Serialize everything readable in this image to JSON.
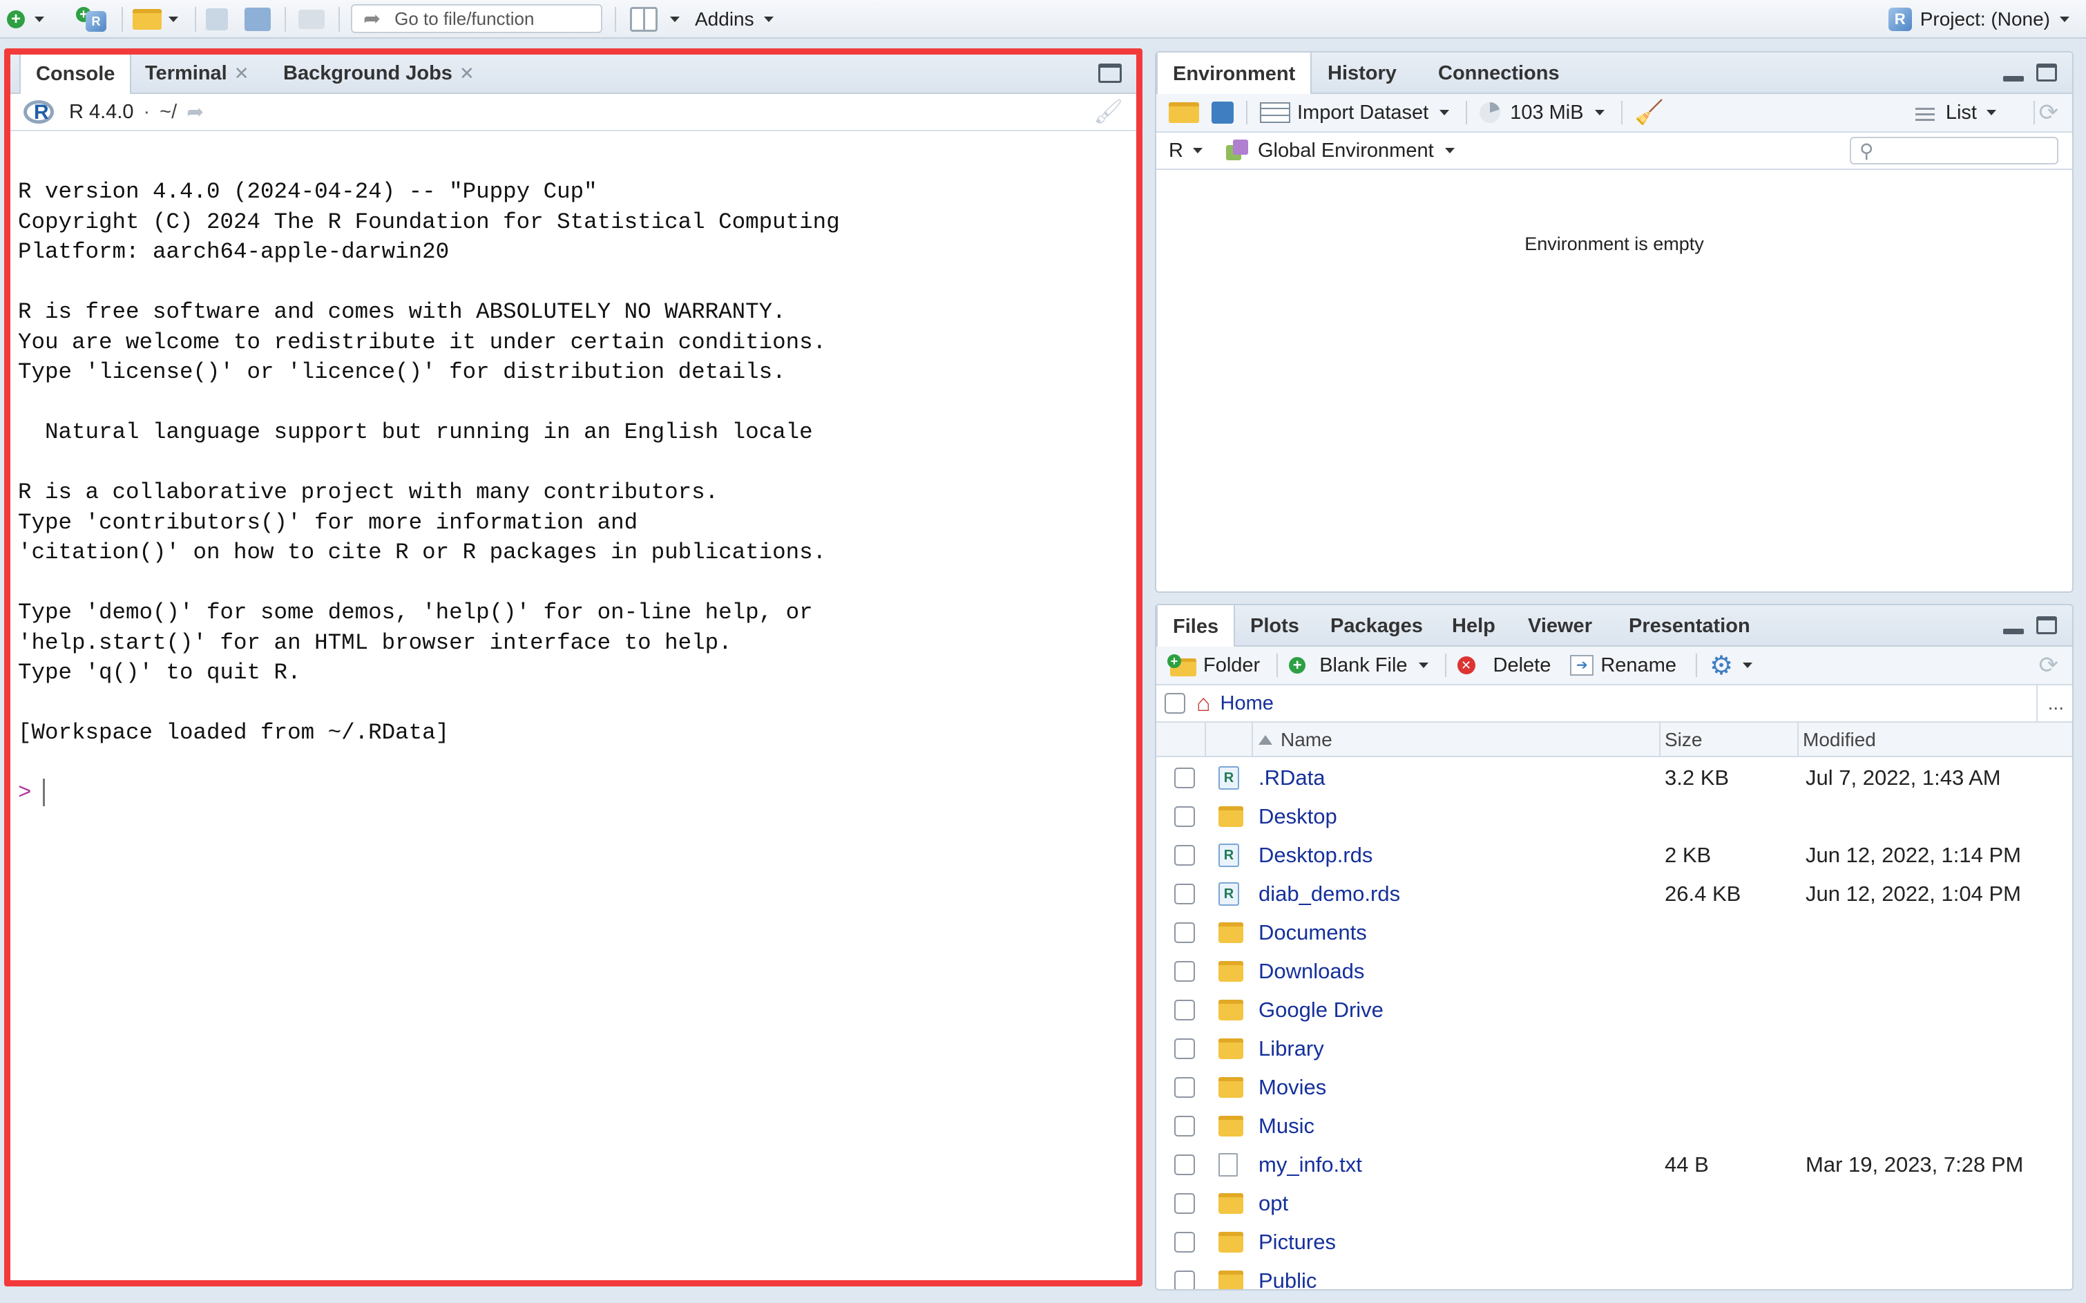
{
  "toolbar": {
    "goto_placeholder": "Go to file/function",
    "addins_label": "Addins",
    "project_label": "Project: (None)"
  },
  "console_pane": {
    "tabs": [
      {
        "label": "Console",
        "closable": false
      },
      {
        "label": "Terminal",
        "closable": true
      },
      {
        "label": "Background Jobs",
        "closable": true
      }
    ],
    "r_version_label": "R 4.4.0",
    "path_label": "~/",
    "output_lines": [
      "R version 4.4.0 (2024-04-24) -- \"Puppy Cup\"",
      "Copyright (C) 2024 The R Foundation for Statistical Computing",
      "Platform: aarch64-apple-darwin20",
      "",
      "R is free software and comes with ABSOLUTELY NO WARRANTY.",
      "You are welcome to redistribute it under certain conditions.",
      "Type 'license()' or 'licence()' for distribution details.",
      "",
      "  Natural language support but running in an English locale",
      "",
      "R is a collaborative project with many contributors.",
      "Type 'contributors()' for more information and",
      "'citation()' on how to cite R or R packages in publications.",
      "",
      "Type 'demo()' for some demos, 'help()' for on-line help, or",
      "'help.start()' for an HTML browser interface to help.",
      "Type 'q()' to quit R.",
      "",
      "[Workspace loaded from ~/.RData]"
    ],
    "prompt": ">"
  },
  "env_pane": {
    "tabs": [
      "Environment",
      "History",
      "Connections"
    ],
    "import_label": "Import Dataset",
    "memory_label": "103 MiB",
    "view_label": "List",
    "language_label": "R",
    "scope_label": "Global Environment",
    "empty_message": "Environment is empty"
  },
  "files_pane": {
    "tabs": [
      "Files",
      "Plots",
      "Packages",
      "Help",
      "Viewer",
      "Presentation"
    ],
    "folder_label": "Folder",
    "blank_file_label": "Blank File",
    "delete_label": "Delete",
    "rename_label": "Rename",
    "breadcrumb": "Home",
    "more_label": "...",
    "columns": {
      "name": "Name",
      "size": "Size",
      "modified": "Modified"
    },
    "files": [
      {
        "name": ".RData",
        "type": "rdata",
        "size": "3.2 KB",
        "modified": "Jul 7, 2022, 1:43 AM"
      },
      {
        "name": "Desktop",
        "type": "folder",
        "size": "",
        "modified": ""
      },
      {
        "name": "Desktop.rds",
        "type": "rdata",
        "size": "2 KB",
        "modified": "Jun 12, 2022, 1:14 PM"
      },
      {
        "name": "diab_demo.rds",
        "type": "rdata",
        "size": "26.4 KB",
        "modified": "Jun 12, 2022, 1:04 PM"
      },
      {
        "name": "Documents",
        "type": "folder",
        "size": "",
        "modified": ""
      },
      {
        "name": "Downloads",
        "type": "folder",
        "size": "",
        "modified": ""
      },
      {
        "name": "Google Drive",
        "type": "folder",
        "size": "",
        "modified": ""
      },
      {
        "name": "Library",
        "type": "folder",
        "size": "",
        "modified": ""
      },
      {
        "name": "Movies",
        "type": "folder",
        "size": "",
        "modified": ""
      },
      {
        "name": "Music",
        "type": "folder",
        "size": "",
        "modified": ""
      },
      {
        "name": "my_info.txt",
        "type": "text",
        "size": "44 B",
        "modified": "Mar 19, 2023, 7:28 PM"
      },
      {
        "name": "opt",
        "type": "folder",
        "size": "",
        "modified": ""
      },
      {
        "name": "Pictures",
        "type": "folder",
        "size": "",
        "modified": ""
      },
      {
        "name": "Public",
        "type": "folder",
        "size": "",
        "modified": ""
      }
    ]
  },
  "colors": {
    "highlight_border": "#f23a3a",
    "link": "#15309b",
    "prompt": "#b0359a"
  }
}
